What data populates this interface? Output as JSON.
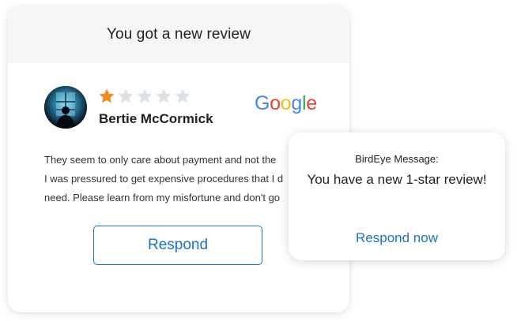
{
  "review_card": {
    "title": "You got a new review",
    "reviewer": {
      "name": "Bertie McCormick",
      "avatar": "profile-photo"
    },
    "rating": {
      "value": 1,
      "max": 5,
      "filled_color": "#f08a1c",
      "empty_color": "#dce1e6"
    },
    "source": {
      "name": "Google",
      "letters": [
        "G",
        "o",
        "o",
        "g",
        "l",
        "e"
      ],
      "colors": [
        "#4285F4",
        "#EA4335",
        "#FBBC05",
        "#4285F4",
        "#34A853",
        "#EA4335"
      ]
    },
    "review_lines": [
      "They seem to only care about payment and not the",
      "I was pressured to get expensive procedures that I d",
      "need. Please learn from my misfortune and don't go"
    ],
    "respond_label": "Respond",
    "accent_color": "#1a73c9"
  },
  "notification": {
    "label": "BirdEye Message:",
    "message": "You have a new 1-star review!",
    "action_label": "Respond now"
  }
}
